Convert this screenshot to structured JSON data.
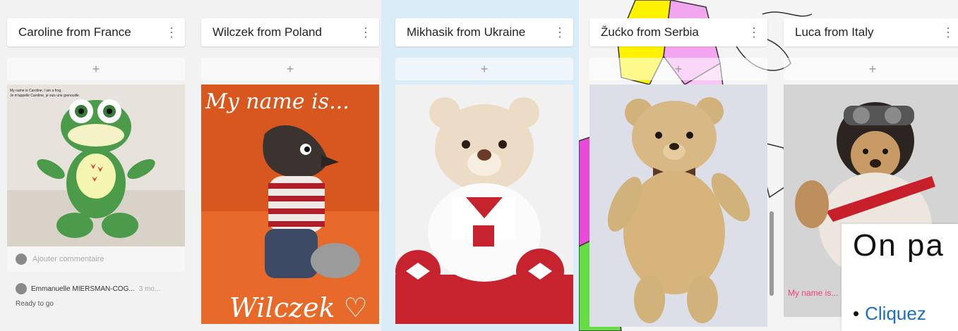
{
  "columns": [
    {
      "title": "Caroline from France",
      "add": "+",
      "menu": "⋮",
      "photo_caption_1": "My name is Caroline, I am a frog.",
      "photo_caption_2": "Je m'appelle Caroline, je suis une grenouille.",
      "comment_placeholder": "Ajouter commentaire",
      "comment_author": "Emmanuelle MIERSMAN-COG...",
      "comment_time": "3 mo...",
      "comment_text": "Ready to go"
    },
    {
      "title": "Wilczek from Poland",
      "add": "+",
      "menu": "⋮",
      "photo_text_top": "My name is...",
      "photo_text_bottom": "Wilczek ♡"
    },
    {
      "title": "Mikhasik from Ukraine",
      "add": "+",
      "menu": "⋮"
    },
    {
      "title": "Žućko from Serbia",
      "add": "+",
      "menu": "⋮"
    },
    {
      "title": "Luca from Italy",
      "add": "+",
      "menu": "⋮",
      "photo_text": "My name is..."
    }
  ],
  "overlay": {
    "title": "On pa",
    "bullet": "Cliquez"
  },
  "colors": {
    "card_bg": "#ffffff",
    "blue_column_bg": "#d9ecf8",
    "link_blue": "#1a6fc4"
  }
}
